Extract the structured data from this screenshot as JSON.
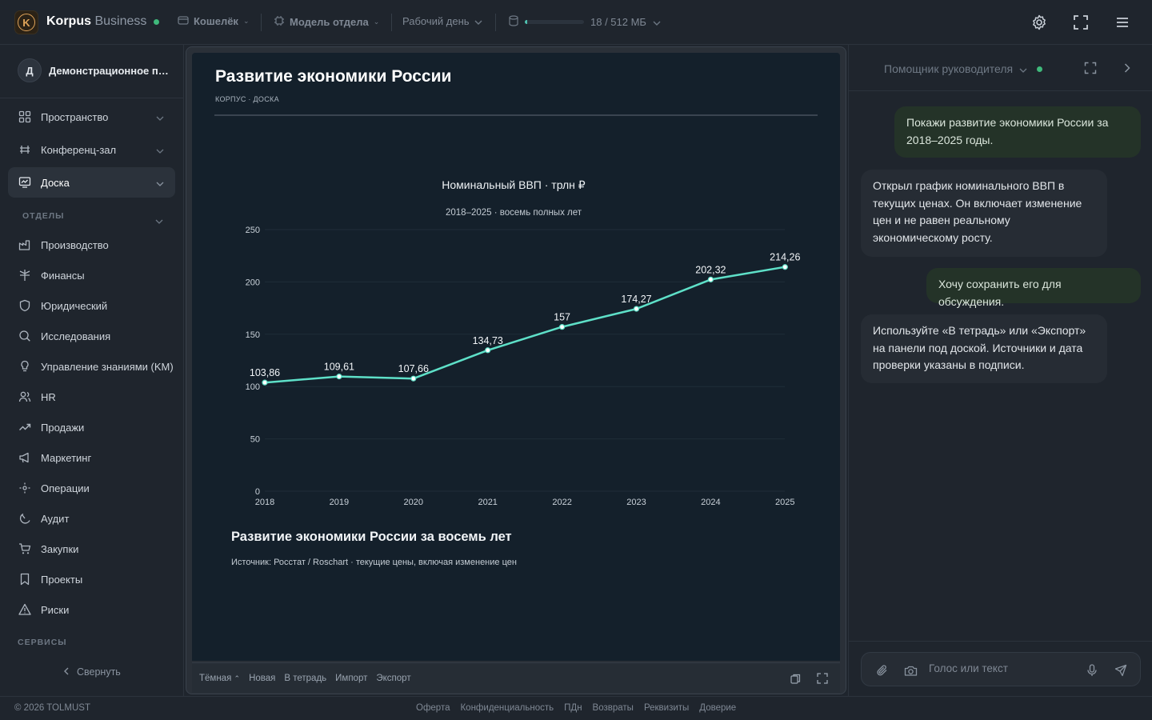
{
  "app": {
    "brand_name": "Korpus",
    "brand_tier": "Business",
    "logo_letter": "K"
  },
  "topbar": {
    "wallet_label": "Кошелёк",
    "model_label": "Модель отдела",
    "workday_label": "Рабочий день",
    "storage_text": "18 / 512 МБ",
    "storage_used_fraction": 0.035
  },
  "sidebar": {
    "org_avatar": "Д",
    "org_name": "Демонстрационное пространство",
    "top_items": [
      {
        "label": "Пространство",
        "icon": "grid-icon"
      },
      {
        "label": "Конференц-зал",
        "icon": "table-icon"
      },
      {
        "label": "Доска",
        "icon": "board-icon",
        "active": true
      }
    ],
    "departments_title": "ОТДЕЛЫ",
    "departments": [
      {
        "label": "Производство",
        "icon": "factory-icon"
      },
      {
        "label": "Финансы",
        "icon": "finance-icon"
      },
      {
        "label": "Юридический",
        "icon": "shield-icon"
      },
      {
        "label": "Исследования",
        "icon": "search-icon"
      },
      {
        "label": "Управление знаниями (KM)",
        "icon": "lightbulb-icon"
      },
      {
        "label": "HR",
        "icon": "users-icon"
      },
      {
        "label": "Продажи",
        "icon": "trend-icon"
      },
      {
        "label": "Маркетинг",
        "icon": "megaphone-icon"
      },
      {
        "label": "Операции",
        "icon": "cog-icon"
      },
      {
        "label": "Аудит",
        "icon": "audit-icon"
      },
      {
        "label": "Закупки",
        "icon": "cart-icon"
      },
      {
        "label": "Проекты",
        "icon": "bookmark-icon"
      },
      {
        "label": "Риски",
        "icon": "warning-icon"
      }
    ],
    "services_title": "СЕРВИСЫ",
    "collapse_label": "Свернуть"
  },
  "board": {
    "title": "Развитие экономики России",
    "subtitle": "КОРПУС · ДОСКА",
    "caption_title": "Развитие экономики России за восемь лет",
    "caption_source": "Источник: Росстат / Roschart · текущие цены, включая изменение цен",
    "toolbar": {
      "theme": "Тёмная",
      "new": "Новая",
      "to_notebook": "В тетрадь",
      "import": "Импорт",
      "export": "Экспорт"
    }
  },
  "chart_data": {
    "type": "line",
    "title": "Номинальный ВВП · трлн ₽",
    "subtitle": "2018–2025 · восемь полных лет",
    "x": [
      "2018",
      "2019",
      "2020",
      "2021",
      "2022",
      "2023",
      "2024",
      "2025"
    ],
    "values": [
      103.86,
      109.61,
      107.66,
      134.73,
      157,
      174.27,
      202.32,
      214.26
    ],
    "data_labels": [
      "103,86",
      "109,61",
      "107,66",
      "134,73",
      "157",
      "174,27",
      "202,32",
      "214,26"
    ],
    "yticks": [
      "0",
      "50",
      "100",
      "150",
      "200",
      "250"
    ],
    "ylim": [
      0,
      250
    ],
    "grid": true,
    "line_color": "#5ee0c8"
  },
  "assistant": {
    "title": "Помощник руководителя",
    "messages": [
      {
        "role": "user",
        "text": "Покажи развитие экономики России за 2018–2025 годы."
      },
      {
        "role": "bot",
        "text": "Открыл график номинального ВВП в текущих ценах. Он включает изменение цен и не равен реальному экономическому росту."
      },
      {
        "role": "user",
        "text": "Хочу сохранить его для обсуждения."
      },
      {
        "role": "bot",
        "text": "Используйте «В тетрадь» или «Экспорт» на панели под доской. Источники и дата проверки указаны в подписи."
      }
    ],
    "input_placeholder": "Голос или текст"
  },
  "footer": {
    "copyright": "© 2026 TOLMUST",
    "links": [
      "Оферта",
      "Конфиденциальность",
      "ПДн",
      "Возвраты",
      "Реквизиты",
      "Доверие"
    ]
  }
}
